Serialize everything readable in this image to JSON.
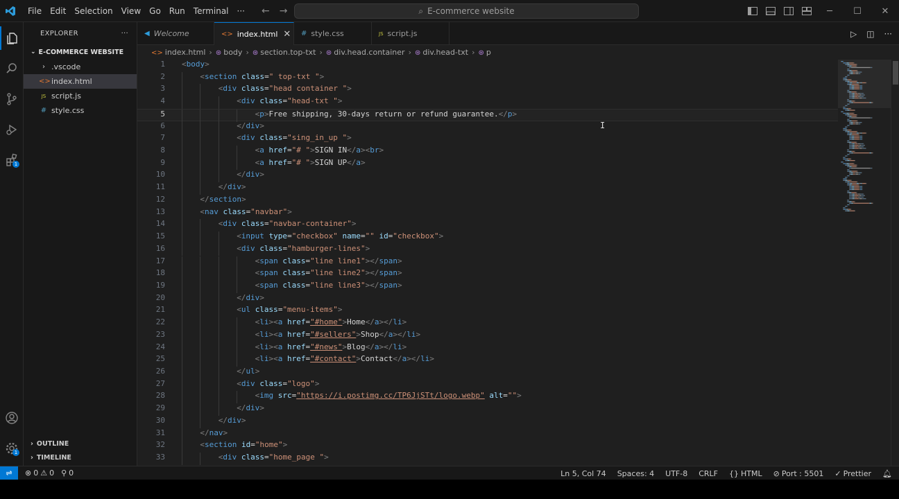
{
  "titlebar": {
    "menu": [
      "File",
      "Edit",
      "Selection",
      "View",
      "Go",
      "Run",
      "Terminal",
      "···"
    ],
    "search_text": "E-commerce website"
  },
  "sidebar": {
    "header": "EXPLORER",
    "more": "···",
    "project": "E-COMMERCE WEBSITE",
    "files": [
      {
        "name": ".vscode",
        "type": "folder"
      },
      {
        "name": "index.html",
        "type": "html",
        "selected": true
      },
      {
        "name": "script.js",
        "type": "js"
      },
      {
        "name": "style.css",
        "type": "css"
      }
    ],
    "outline": "OUTLINE",
    "timeline": "TIMELINE"
  },
  "tabs": [
    {
      "label": "Welcome",
      "icon": "vscode-icon"
    },
    {
      "label": "index.html",
      "icon": "html-icon",
      "active": true
    },
    {
      "label": "style.css",
      "icon": "css-icon"
    },
    {
      "label": "script.js",
      "icon": "js-icon"
    }
  ],
  "breadcrumb": [
    "index.html",
    "body",
    "section.top-txt",
    "div.head.container",
    "div.head-txt",
    "p"
  ],
  "editor": {
    "current_line": 5,
    "lines": [
      {
        "n": 1,
        "i": 0,
        "t": [
          [
            "p",
            "<"
          ],
          [
            "t",
            "body"
          ],
          [
            "p",
            ">"
          ]
        ]
      },
      {
        "n": 2,
        "i": 1,
        "t": [
          [
            "p",
            "<"
          ],
          [
            "t",
            "section"
          ],
          [
            "x",
            " "
          ],
          [
            "a",
            "class"
          ],
          [
            "x",
            "="
          ],
          [
            "s",
            "\" top-txt \""
          ],
          [
            "p",
            ">"
          ]
        ]
      },
      {
        "n": 3,
        "i": 2,
        "t": [
          [
            "p",
            "<"
          ],
          [
            "t",
            "div"
          ],
          [
            "x",
            " "
          ],
          [
            "a",
            "class"
          ],
          [
            "x",
            "="
          ],
          [
            "s",
            "\"head container \""
          ],
          [
            "p",
            ">"
          ]
        ]
      },
      {
        "n": 4,
        "i": 3,
        "t": [
          [
            "p",
            "<"
          ],
          [
            "t",
            "div"
          ],
          [
            "x",
            " "
          ],
          [
            "a",
            "class"
          ],
          [
            "x",
            "="
          ],
          [
            "s",
            "\"head-txt \""
          ],
          [
            "p",
            ">"
          ]
        ]
      },
      {
        "n": 5,
        "i": 4,
        "t": [
          [
            "p",
            "<"
          ],
          [
            "t",
            "p"
          ],
          [
            "p",
            ">"
          ],
          [
            "x",
            "Free shipping, 30-days return or refund guarantee."
          ],
          [
            "p",
            "</"
          ],
          [
            "t",
            "p"
          ],
          [
            "p",
            ">"
          ]
        ]
      },
      {
        "n": 6,
        "i": 3,
        "t": [
          [
            "p",
            "</"
          ],
          [
            "t",
            "div"
          ],
          [
            "p",
            ">"
          ]
        ]
      },
      {
        "n": 7,
        "i": 3,
        "t": [
          [
            "p",
            "<"
          ],
          [
            "t",
            "div"
          ],
          [
            "x",
            " "
          ],
          [
            "a",
            "class"
          ],
          [
            "x",
            "="
          ],
          [
            "s",
            "\"sing_in_up \""
          ],
          [
            "p",
            ">"
          ]
        ]
      },
      {
        "n": 8,
        "i": 4,
        "t": [
          [
            "p",
            "<"
          ],
          [
            "t",
            "a"
          ],
          [
            "x",
            " "
          ],
          [
            "a",
            "href"
          ],
          [
            "x",
            "="
          ],
          [
            "s",
            "\"# \""
          ],
          [
            "p",
            ">"
          ],
          [
            "x",
            "SIGN IN"
          ],
          [
            "p",
            "</"
          ],
          [
            "t",
            "a"
          ],
          [
            "p",
            "><"
          ],
          [
            "t",
            "br"
          ],
          [
            "p",
            ">"
          ]
        ]
      },
      {
        "n": 9,
        "i": 4,
        "t": [
          [
            "p",
            "<"
          ],
          [
            "t",
            "a"
          ],
          [
            "x",
            " "
          ],
          [
            "a",
            "href"
          ],
          [
            "x",
            "="
          ],
          [
            "s",
            "\"# \""
          ],
          [
            "p",
            ">"
          ],
          [
            "x",
            "SIGN UP"
          ],
          [
            "p",
            "</"
          ],
          [
            "t",
            "a"
          ],
          [
            "p",
            ">"
          ]
        ]
      },
      {
        "n": 10,
        "i": 3,
        "t": [
          [
            "p",
            "</"
          ],
          [
            "t",
            "div"
          ],
          [
            "p",
            ">"
          ]
        ]
      },
      {
        "n": 11,
        "i": 2,
        "t": [
          [
            "p",
            "</"
          ],
          [
            "t",
            "div"
          ],
          [
            "p",
            ">"
          ]
        ]
      },
      {
        "n": 12,
        "i": 1,
        "t": [
          [
            "p",
            "</"
          ],
          [
            "t",
            "section"
          ],
          [
            "p",
            ">"
          ]
        ]
      },
      {
        "n": 13,
        "i": 1,
        "t": [
          [
            "p",
            "<"
          ],
          [
            "t",
            "nav"
          ],
          [
            "x",
            " "
          ],
          [
            "a",
            "class"
          ],
          [
            "x",
            "="
          ],
          [
            "s",
            "\"navbar\""
          ],
          [
            "p",
            ">"
          ]
        ]
      },
      {
        "n": 14,
        "i": 2,
        "t": [
          [
            "p",
            "<"
          ],
          [
            "t",
            "div"
          ],
          [
            "x",
            " "
          ],
          [
            "a",
            "class"
          ],
          [
            "x",
            "="
          ],
          [
            "s",
            "\"navbar-container\""
          ],
          [
            "p",
            ">"
          ]
        ]
      },
      {
        "n": 15,
        "i": 3,
        "t": [
          [
            "p",
            "<"
          ],
          [
            "t",
            "input"
          ],
          [
            "x",
            " "
          ],
          [
            "a",
            "type"
          ],
          [
            "x",
            "="
          ],
          [
            "s",
            "\"checkbox\""
          ],
          [
            "x",
            " "
          ],
          [
            "a",
            "name"
          ],
          [
            "x",
            "="
          ],
          [
            "s",
            "\"\""
          ],
          [
            "x",
            " "
          ],
          [
            "a",
            "id"
          ],
          [
            "x",
            "="
          ],
          [
            "s",
            "\"checkbox\""
          ],
          [
            "p",
            ">"
          ]
        ]
      },
      {
        "n": 16,
        "i": 3,
        "t": [
          [
            "p",
            "<"
          ],
          [
            "t",
            "div"
          ],
          [
            "x",
            " "
          ],
          [
            "a",
            "class"
          ],
          [
            "x",
            "="
          ],
          [
            "s",
            "\"hamburger-lines\""
          ],
          [
            "p",
            ">"
          ]
        ]
      },
      {
        "n": 17,
        "i": 4,
        "t": [
          [
            "p",
            "<"
          ],
          [
            "t",
            "span"
          ],
          [
            "x",
            " "
          ],
          [
            "a",
            "class"
          ],
          [
            "x",
            "="
          ],
          [
            "s",
            "\"line line1\""
          ],
          [
            "p",
            "></"
          ],
          [
            "t",
            "span"
          ],
          [
            "p",
            ">"
          ]
        ]
      },
      {
        "n": 18,
        "i": 4,
        "t": [
          [
            "p",
            "<"
          ],
          [
            "t",
            "span"
          ],
          [
            "x",
            " "
          ],
          [
            "a",
            "class"
          ],
          [
            "x",
            "="
          ],
          [
            "s",
            "\"line line2\""
          ],
          [
            "p",
            "></"
          ],
          [
            "t",
            "span"
          ],
          [
            "p",
            ">"
          ]
        ]
      },
      {
        "n": 19,
        "i": 4,
        "t": [
          [
            "p",
            "<"
          ],
          [
            "t",
            "span"
          ],
          [
            "x",
            " "
          ],
          [
            "a",
            "class"
          ],
          [
            "x",
            "="
          ],
          [
            "s",
            "\"line line3\""
          ],
          [
            "p",
            "></"
          ],
          [
            "t",
            "span"
          ],
          [
            "p",
            ">"
          ]
        ]
      },
      {
        "n": 20,
        "i": 3,
        "t": [
          [
            "p",
            "</"
          ],
          [
            "t",
            "div"
          ],
          [
            "p",
            ">"
          ]
        ]
      },
      {
        "n": 21,
        "i": 3,
        "t": [
          [
            "p",
            "<"
          ],
          [
            "t",
            "ul"
          ],
          [
            "x",
            " "
          ],
          [
            "a",
            "class"
          ],
          [
            "x",
            "="
          ],
          [
            "s",
            "\"menu-items\""
          ],
          [
            "p",
            ">"
          ]
        ]
      },
      {
        "n": 22,
        "i": 4,
        "t": [
          [
            "p",
            "<"
          ],
          [
            "t",
            "li"
          ],
          [
            "p",
            "><"
          ],
          [
            "t",
            "a"
          ],
          [
            "x",
            " "
          ],
          [
            "a",
            "href"
          ],
          [
            "x",
            "="
          ],
          [
            "su",
            "\"#home\""
          ],
          [
            "p",
            ">"
          ],
          [
            "x",
            "Home"
          ],
          [
            "p",
            "</"
          ],
          [
            "t",
            "a"
          ],
          [
            "p",
            "></"
          ],
          [
            "t",
            "li"
          ],
          [
            "p",
            ">"
          ]
        ]
      },
      {
        "n": 23,
        "i": 4,
        "t": [
          [
            "p",
            "<"
          ],
          [
            "t",
            "li"
          ],
          [
            "p",
            "><"
          ],
          [
            "t",
            "a"
          ],
          [
            "x",
            " "
          ],
          [
            "a",
            "href"
          ],
          [
            "x",
            "="
          ],
          [
            "su",
            "\"#sellers\""
          ],
          [
            "p",
            ">"
          ],
          [
            "x",
            "Shop"
          ],
          [
            "p",
            "</"
          ],
          [
            "t",
            "a"
          ],
          [
            "p",
            "></"
          ],
          [
            "t",
            "li"
          ],
          [
            "p",
            ">"
          ]
        ]
      },
      {
        "n": 24,
        "i": 4,
        "t": [
          [
            "p",
            "<"
          ],
          [
            "t",
            "li"
          ],
          [
            "p",
            "><"
          ],
          [
            "t",
            "a"
          ],
          [
            "x",
            " "
          ],
          [
            "a",
            "href"
          ],
          [
            "x",
            "="
          ],
          [
            "su",
            "\"#news\""
          ],
          [
            "p",
            ">"
          ],
          [
            "x",
            "Blog"
          ],
          [
            "p",
            "</"
          ],
          [
            "t",
            "a"
          ],
          [
            "p",
            "></"
          ],
          [
            "t",
            "li"
          ],
          [
            "p",
            ">"
          ]
        ]
      },
      {
        "n": 25,
        "i": 4,
        "t": [
          [
            "p",
            "<"
          ],
          [
            "t",
            "li"
          ],
          [
            "p",
            "><"
          ],
          [
            "t",
            "a"
          ],
          [
            "x",
            " "
          ],
          [
            "a",
            "href"
          ],
          [
            "x",
            "="
          ],
          [
            "su",
            "\"#contact\""
          ],
          [
            "p",
            ">"
          ],
          [
            "x",
            "Contact"
          ],
          [
            "p",
            "</"
          ],
          [
            "t",
            "a"
          ],
          [
            "p",
            "></"
          ],
          [
            "t",
            "li"
          ],
          [
            "p",
            ">"
          ]
        ]
      },
      {
        "n": 26,
        "i": 3,
        "t": [
          [
            "p",
            "</"
          ],
          [
            "t",
            "ul"
          ],
          [
            "p",
            ">"
          ]
        ]
      },
      {
        "n": 27,
        "i": 3,
        "t": [
          [
            "p",
            "<"
          ],
          [
            "t",
            "div"
          ],
          [
            "x",
            " "
          ],
          [
            "a",
            "class"
          ],
          [
            "x",
            "="
          ],
          [
            "s",
            "\"logo\""
          ],
          [
            "p",
            ">"
          ]
        ]
      },
      {
        "n": 28,
        "i": 4,
        "t": [
          [
            "p",
            "<"
          ],
          [
            "t",
            "img"
          ],
          [
            "x",
            " "
          ],
          [
            "a",
            "src"
          ],
          [
            "x",
            "="
          ],
          [
            "su",
            "\"https://i.postimg.cc/TP6JjSTt/logo.webp\""
          ],
          [
            "x",
            " "
          ],
          [
            "a",
            "alt"
          ],
          [
            "x",
            "="
          ],
          [
            "s",
            "\"\""
          ],
          [
            "p",
            ">"
          ]
        ]
      },
      {
        "n": 29,
        "i": 3,
        "t": [
          [
            "p",
            "</"
          ],
          [
            "t",
            "div"
          ],
          [
            "p",
            ">"
          ]
        ]
      },
      {
        "n": 30,
        "i": 2,
        "t": [
          [
            "p",
            "</"
          ],
          [
            "t",
            "div"
          ],
          [
            "p",
            ">"
          ]
        ]
      },
      {
        "n": 31,
        "i": 1,
        "t": [
          [
            "p",
            "</"
          ],
          [
            "t",
            "nav"
          ],
          [
            "p",
            ">"
          ]
        ]
      },
      {
        "n": 32,
        "i": 1,
        "t": [
          [
            "p",
            "<"
          ],
          [
            "t",
            "section"
          ],
          [
            "x",
            " "
          ],
          [
            "a",
            "id"
          ],
          [
            "x",
            "="
          ],
          [
            "s",
            "\"home\""
          ],
          [
            "p",
            ">"
          ]
        ]
      },
      {
        "n": 33,
        "i": 2,
        "t": [
          [
            "p",
            "<"
          ],
          [
            "t",
            "div"
          ],
          [
            "x",
            " "
          ],
          [
            "a",
            "class"
          ],
          [
            "x",
            "="
          ],
          [
            "s",
            "\"home_page \""
          ],
          [
            "p",
            ">"
          ]
        ]
      }
    ]
  },
  "statusbar": {
    "problems_errors": "0",
    "problems_warnings": "0",
    "ports": "0",
    "position": "Ln 5, Col 74",
    "spaces": "Spaces: 4",
    "encoding": "UTF-8",
    "eol": "CRLF",
    "language": "HTML",
    "port": "Port : 5501",
    "prettier": "Prettier"
  },
  "colors": {
    "accent": "#0078d4",
    "tag": "#569cd6",
    "attr": "#9cdcfe",
    "string": "#ce9178"
  }
}
